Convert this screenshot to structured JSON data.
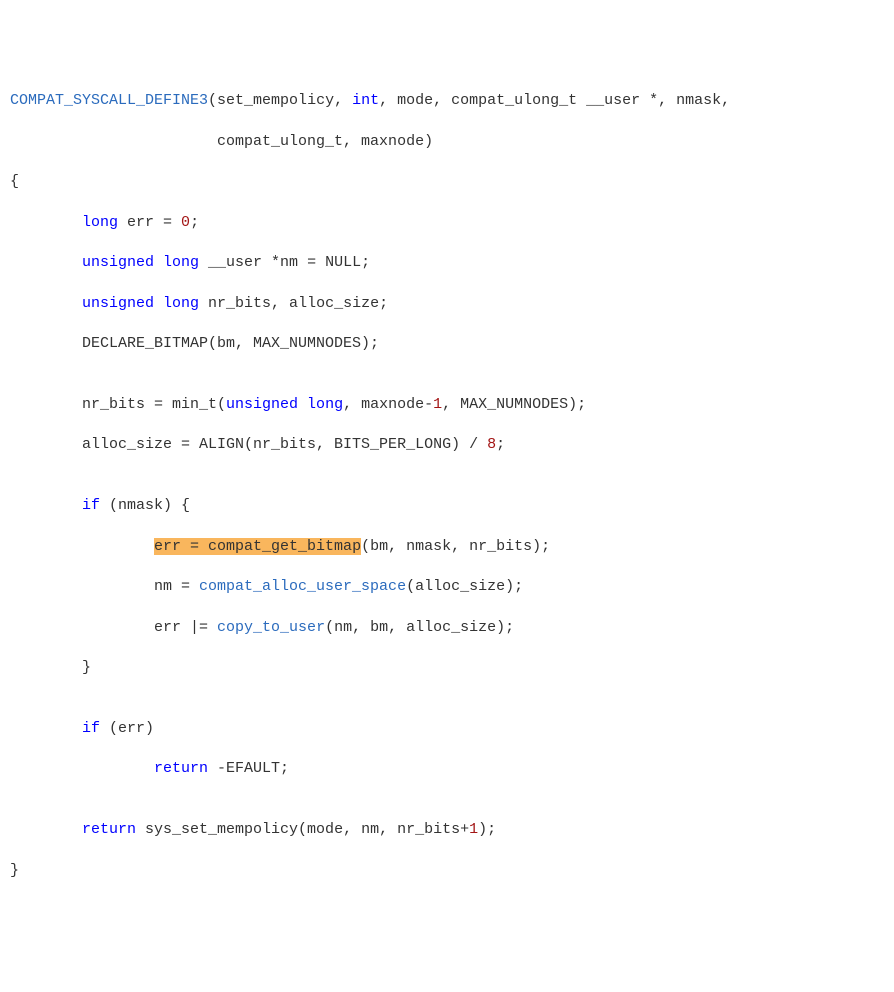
{
  "code": {
    "l1_a": "COMPAT_SYSCALL_DEFINE3",
    "l1_b": "(set_mempolicy, ",
    "l1_c": "int",
    "l1_d": ", mode, compat_ulong_t __user *, nmask,",
    "l2_a": "                       compat_ulong_t, maxnode)",
    "l3": "{",
    "l4_a": "        ",
    "l4_b": "long",
    "l4_c": " err = ",
    "l4_d": "0",
    "l4_e": ";",
    "l5_a": "        ",
    "l5_b": "unsigned long",
    "l5_c": " __user *nm = NULL;",
    "l6_a": "        ",
    "l6_b": "unsigned long",
    "l6_c": " nr_bits, alloc_size;",
    "l7_a": "        DECLARE_BITMAP(bm, MAX_NUMNODES);",
    "l8": "",
    "l9_a": "        nr_bits = min_t(",
    "l9_b": "unsigned long",
    "l9_c": ", maxnode-",
    "l9_d": "1",
    "l9_e": ", MAX_NUMNODES);",
    "l10_a": "        alloc_size = ALIGN(nr_bits, BITS_PER_LONG) / ",
    "l10_b": "8",
    "l10_c": ";",
    "l11": "",
    "l12_a": "        ",
    "l12_b": "if",
    "l12_c": " (nmask) {",
    "l13_a": "                ",
    "l13_h": "err = compat_get_bitmap",
    "l13_b": "(bm, nmask, nr_bits);",
    "l14_a": "                nm = ",
    "l14_b": "compat_alloc_user_space",
    "l14_c": "(alloc_size);",
    "l15_a": "                err |= ",
    "l15_b": "copy_to_user",
    "l15_c": "(nm, bm, alloc_size);",
    "l16": "        }",
    "l17": "",
    "l18_a": "        ",
    "l18_b": "if",
    "l18_c": " (err)",
    "l19_a": "                ",
    "l19_b": "return",
    "l19_c": " -EFAULT;",
    "l20": "",
    "l21_a": "        ",
    "l21_b": "return",
    "l21_c": " sys_set_mempolicy(mode, nm, nr_bits+",
    "l21_d": "1",
    "l21_e": ");",
    "l22": "}"
  }
}
